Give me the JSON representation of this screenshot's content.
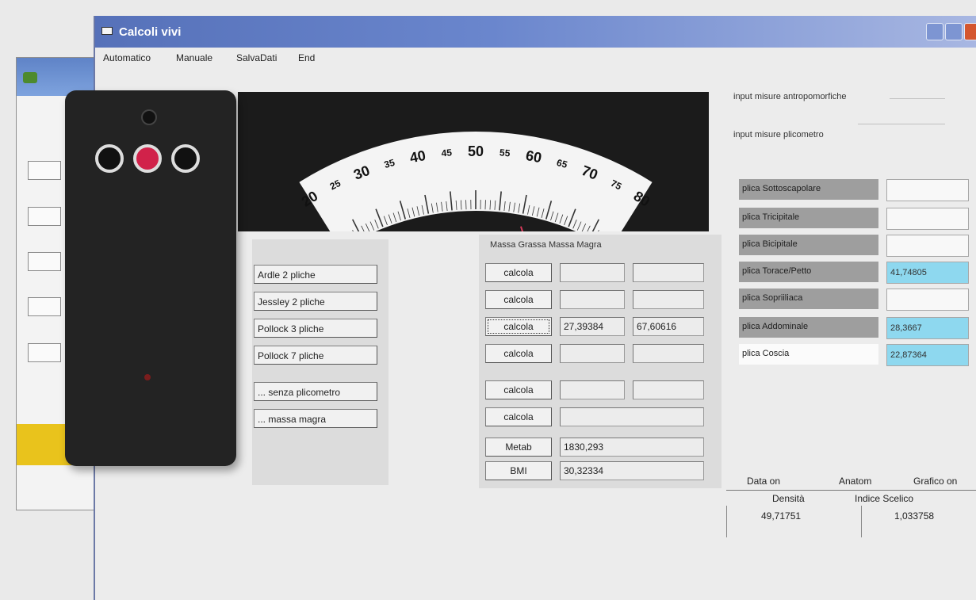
{
  "window": {
    "title": "Calcoli vivi"
  },
  "menu": [
    "Automatico",
    "Manuale",
    "SalvaDati",
    "End"
  ],
  "dial": {
    "ticks": [
      "20",
      "25",
      "30",
      "35",
      "40",
      "45",
      "50",
      "55",
      "60",
      "65",
      "70",
      "75",
      "80"
    ]
  },
  "left_buttons": [
    "Ardle 2 pliche",
    "Jessley 2 pliche",
    "Pollock 3 pliche",
    "Pollock 7 pliche",
    "... senza plicometro",
    "... massa magra"
  ],
  "calc": {
    "header": "Massa Grassa Massa Magra",
    "rows": [
      {
        "label": "calcola",
        "v1": "",
        "v2": ""
      },
      {
        "label": "calcola",
        "v1": "",
        "v2": ""
      },
      {
        "label": "calcola",
        "v1": "27,39384",
        "v2": "67,60616"
      },
      {
        "label": "calcola",
        "v1": "",
        "v2": ""
      },
      {
        "label": "calcola",
        "v1": "",
        "v2": ""
      },
      {
        "label": "calcola",
        "v1": ""
      },
      {
        "label": "Metab",
        "v1": "1830,293"
      },
      {
        "label": "BMI",
        "v1": "30,32334"
      }
    ]
  },
  "right": {
    "input_antropo": "input misure antropomorfiche",
    "input_plicometro": "input misure plicometro",
    "plica": [
      {
        "label": "plica Sottoscapolare",
        "value": ""
      },
      {
        "label": "plica Tricipitale",
        "value": ""
      },
      {
        "label": "plica Bicipitale",
        "value": ""
      },
      {
        "label": "plica Torace/Petto",
        "value": "41,74805"
      },
      {
        "label": "plica Sopriiliaca",
        "value": ""
      },
      {
        "label": "plica Addominale",
        "value": "28,3667"
      },
      {
        "label": "plica Coscia",
        "value": "22,87364"
      }
    ],
    "tabs": [
      "Data on",
      "Anatom",
      "Grafico on"
    ],
    "results": {
      "densita_label": "Densità",
      "indice_label": "Indice Scelico",
      "densita": "49,71751",
      "indice": "1,033758"
    }
  }
}
